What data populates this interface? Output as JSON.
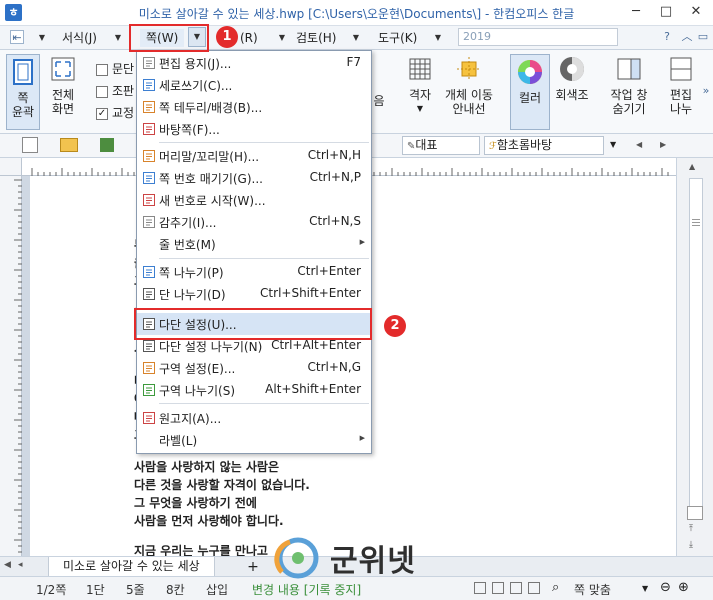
{
  "window": {
    "title": "미소로 살아갈 수 있는 세상.hwp [C:\\Users\\오운현\\Documents\\] - 한컴오피스 한글",
    "app_icon": "ㅎ",
    "controls": [
      "─",
      "□",
      "✕"
    ]
  },
  "menubar": {
    "items": [
      {
        "label": "서식(J)"
      },
      {
        "label": "쪽(W)"
      },
      {
        "label": "(R)"
      },
      {
        "label": "검토(H)"
      },
      {
        "label": "도구(K)"
      }
    ],
    "year_box": "2019",
    "back_icon": "⇤"
  },
  "ribbon": {
    "left_buttons": [
      {
        "label1": "쪽",
        "label2": "윤곽"
      },
      {
        "label1": "전체",
        "label2": "화면"
      }
    ],
    "checks": [
      {
        "label": "문단",
        "checked": false
      },
      {
        "label": "조판",
        "checked": false
      },
      {
        "label": "교정",
        "checked": true
      }
    ],
    "right_buttons": [
      {
        "label1": "음",
        "label2": ""
      },
      {
        "label1": "격자",
        "label2": ""
      },
      {
        "label1": "개체 이동",
        "label2": "안내선"
      },
      {
        "label1": "컬러",
        "label2": ""
      },
      {
        "label1": "회색조",
        "label2": ""
      },
      {
        "label1": "작업 창",
        "label2": "숨기기"
      },
      {
        "label1": "편집",
        "label2": "나누"
      }
    ]
  },
  "toolbar2": {
    "style_select": "대표",
    "font_select": "함초롬바탕"
  },
  "dropdown": {
    "items": [
      {
        "label": "편집 용지(J)...",
        "shortcut": "F7",
        "icon": "paper-icon"
      },
      {
        "label": "세로쓰기(C)...",
        "shortcut": "",
        "icon": "vertical-text-icon"
      },
      {
        "label": "쪽 테두리/배경(B)...",
        "shortcut": "",
        "icon": "page-border-icon"
      },
      {
        "label": "바탕쪽(F)...",
        "shortcut": "",
        "icon": "master-page-icon"
      },
      {
        "label": "머리말/꼬리말(H)...",
        "shortcut": "Ctrl+N,H",
        "icon": "header-footer-icon"
      },
      {
        "label": "쪽 번호 매기기(G)...",
        "shortcut": "Ctrl+N,P",
        "icon": "page-number-icon"
      },
      {
        "label": "새 번호로 시작(W)...",
        "shortcut": "",
        "icon": "new-number-icon"
      },
      {
        "label": "감추기(I)...",
        "shortcut": "Ctrl+N,S",
        "icon": "hide-icon"
      },
      {
        "label": "줄 번호(M)",
        "shortcut": "",
        "icon": "",
        "submenu": true
      },
      {
        "label": "쪽 나누기(P)",
        "shortcut": "Ctrl+Enter",
        "icon": "page-break-icon"
      },
      {
        "label": "단 나누기(D)",
        "shortcut": "Ctrl+Shift+Enter",
        "icon": "column-break-icon"
      },
      {
        "label": "다단 설정(U)...",
        "shortcut": "",
        "icon": "multi-column-icon",
        "highlight": true
      },
      {
        "label": "다단 설정 나누기(N)",
        "shortcut": "Ctrl+Alt+Enter",
        "icon": "multi-column-break-icon"
      },
      {
        "label": "구역 설정(E)...",
        "shortcut": "Ctrl+N,G",
        "icon": "section-setup-icon"
      },
      {
        "label": "구역 나누기(S)",
        "shortcut": "Alt+Shift+Enter",
        "icon": "section-break-icon"
      },
      {
        "label": "원고지(A)...",
        "shortcut": "",
        "icon": "manuscript-icon"
      },
      {
        "label": "라벨(L)",
        "shortcut": "",
        "icon": "",
        "submenu": true
      }
    ]
  },
  "callouts": {
    "badge1": "1",
    "badge2": "2"
  },
  "document": {
    "fragments": [
      "무",
      "을",
      "그",
      "가",
      "나",
      "시",
      "더",
      "어",
      "때",
      "그"
    ],
    "lines": [
      "사람을 사랑하지 않는 사람은",
      "다른 것을 사랑할 자격이 없습니다.",
      "그 무엇을 사랑하기 전에",
      "사람을 먼저 사랑해야 합니다.",
      "지금 우리는 누구를 만나고"
    ]
  },
  "tabbar": {
    "doc_tab": "미소로 살아갈 수 있는 세상",
    "plus": "+"
  },
  "statusbar": {
    "page": "1/2쪽",
    "column": "1단",
    "line": "5줄",
    "col": "8칸",
    "mode": "삽입",
    "track": "변경 내용 [기록 중지]",
    "zoom": "쪽 맞춤"
  },
  "watermark": {
    "text": "군위넷"
  }
}
